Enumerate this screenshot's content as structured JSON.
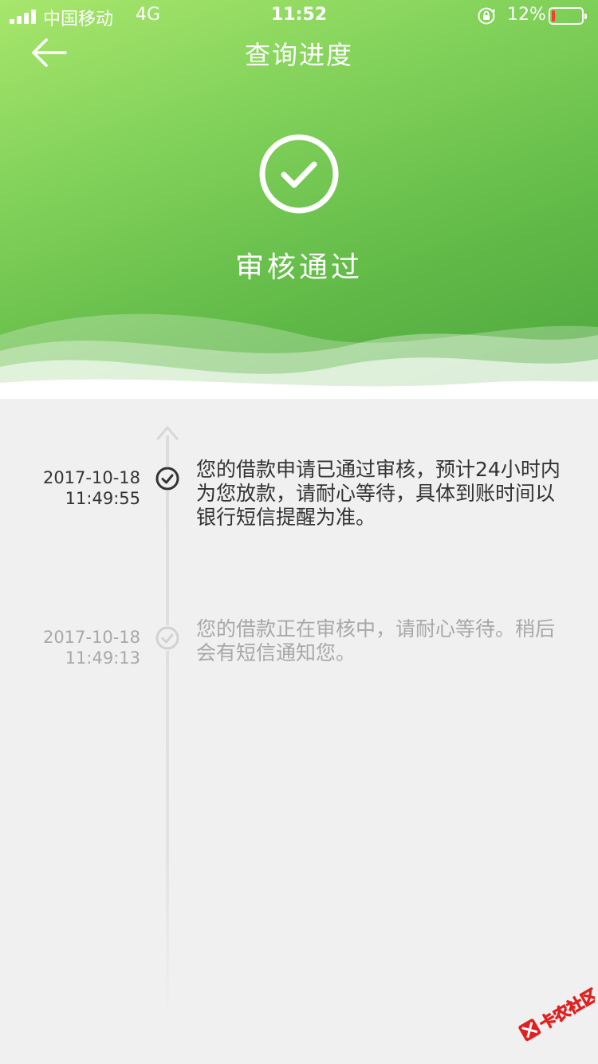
{
  "status_bar": {
    "carrier": "中国移动",
    "network": "4G",
    "time": "11:52",
    "battery": "12%",
    "battery_level": 0.12
  },
  "nav": {
    "title": "查询进度"
  },
  "result": {
    "title": "审核通过"
  },
  "timeline": {
    "entries": [
      {
        "date": "2017-10-18",
        "time": "11:49:55",
        "text": "您的借款申请已通过审核，预计24小时内为您放款，请耐心等待，具体到账时间以银行短信提醒为准。",
        "state": "active"
      },
      {
        "date": "2017-10-18",
        "time": "11:49:13",
        "text": "您的借款正在审核中，请耐心等待。稍后会有短信通知您。",
        "state": "inactive"
      }
    ]
  },
  "watermark": {
    "text": "卡农社区"
  },
  "colors": {
    "header_start": "#a8e66c",
    "header_end": "#4da63e",
    "active_text": "#333333",
    "inactive_text": "#a8a8a8",
    "battery_low": "#ff3b30"
  }
}
